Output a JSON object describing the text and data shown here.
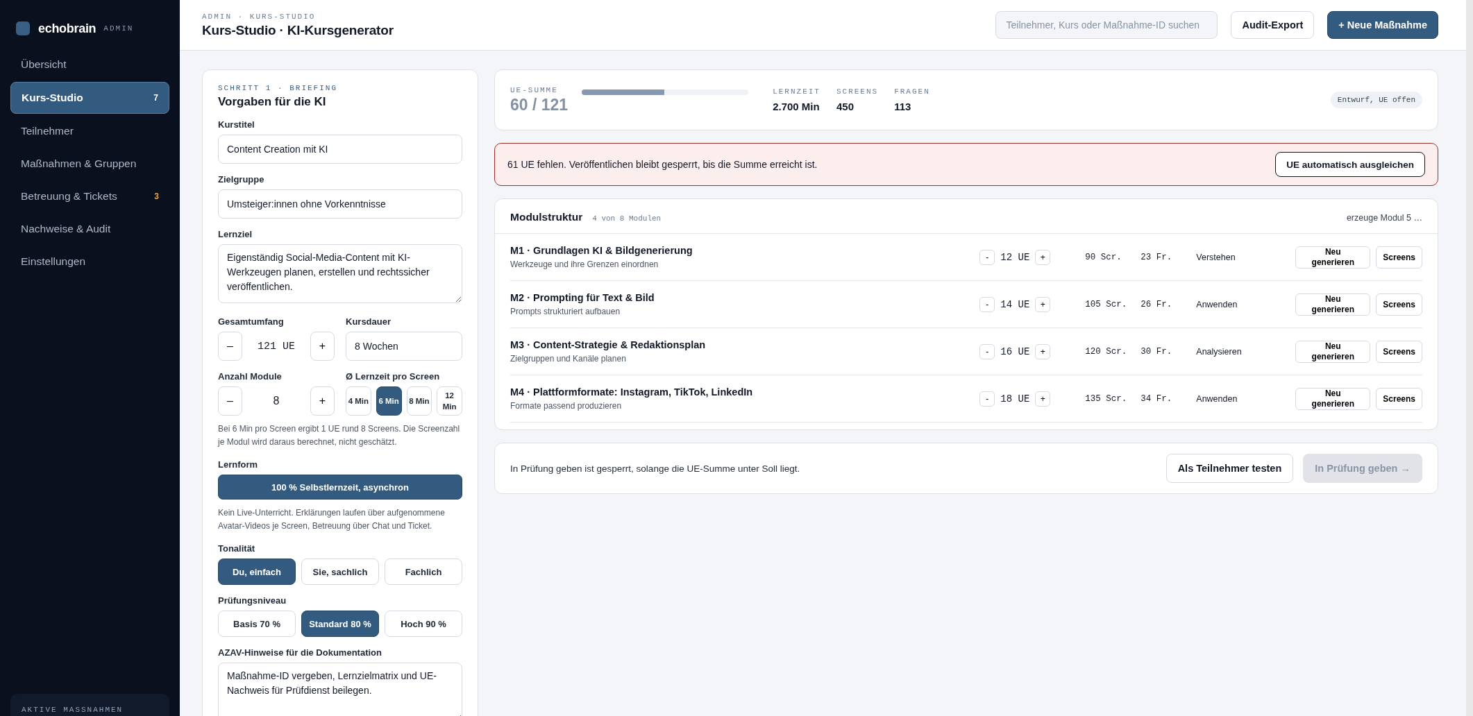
{
  "sidebar": {
    "logo": "echobrain",
    "badge": "ADMIN",
    "items": [
      {
        "label": "Übersicht",
        "selected": false
      },
      {
        "label": "Kurs-Studio",
        "selected": true,
        "count": "7"
      },
      {
        "label": "Teilnehmer",
        "selected": false
      },
      {
        "label": "Maßnahmen & Gruppen",
        "selected": false
      },
      {
        "label": "Betreuung & Tickets",
        "selected": false,
        "count": "3"
      },
      {
        "label": "Nachweise & Audit",
        "selected": false
      },
      {
        "label": "Einstellungen",
        "selected": false
      }
    ],
    "footer_label": "AKTIVE MASSNAHMEN"
  },
  "header": {
    "breadcrumb": "ADMIN · KURS-STUDIO",
    "title": "Kurs-Studio · KI-Kursgenerator",
    "search": {
      "placeholder": "Teilnehmer, Kurs oder Maßnahme-ID suchen"
    },
    "buttons": [
      {
        "label": "Audit-Export",
        "primary": false
      },
      {
        "label": "+ Neue Maßnahme",
        "primary": true
      }
    ]
  },
  "briefing": {
    "step": "SCHRITT 1 · BRIEFING",
    "title": "Vorgaben für die KI",
    "kurstitel": {
      "label": "Kurstitel",
      "value": "Content Creation mit KI"
    },
    "zielgruppe": {
      "label": "Zielgruppe",
      "value": "Umsteiger:innen ohne Vorkenntnisse"
    },
    "lernziel": {
      "label": "Lernziel",
      "value": "Eigenständig Social-Media-Content mit KI-Werkzeugen planen, erstellen und rechtssicher veröffentlichen."
    },
    "gesamtumfang": {
      "label": "Gesamtumfang",
      "minus": "–",
      "value": "121 UE",
      "plus": "+"
    },
    "kursdauer": {
      "label": "Kursdauer",
      "value": "8 Wochen"
    },
    "module_count": {
      "label": "Anzahl Module",
      "minus": "–",
      "value": "8",
      "plus": "+"
    },
    "screen_time": {
      "label": "Ø Lernzeit pro Screen",
      "options": [
        {
          "label": "4 Min",
          "selected": false
        },
        {
          "label": "6 Min",
          "selected": true
        },
        {
          "label": "8 Min",
          "selected": false
        },
        {
          "label": "12 Min",
          "selected": false
        }
      ]
    },
    "screen_note": "Bei 6 Min pro Screen ergibt 1 UE rund 8 Screens. Die Screenzahl je Modul wird daraus berechnet, nicht geschätzt.",
    "lernform": {
      "label": "Lernform",
      "value": "100 % Selbstlernzeit, asynchron",
      "note": "Kein Live-Unterricht. Erklärungen laufen über aufgenommene Avatar-Videos je Screen, Betreuung über Chat und Ticket."
    },
    "tonalitaet": {
      "label": "Tonalität",
      "options": [
        {
          "label": "Du, einfach",
          "selected": true
        },
        {
          "label": "Sie, sachlich",
          "selected": false
        },
        {
          "label": "Fachlich",
          "selected": false
        }
      ]
    },
    "pruefungsniveau": {
      "label": "Prüfungsniveau",
      "options": [
        {
          "label": "Basis 70 %",
          "selected": false
        },
        {
          "label": "Standard 80 %",
          "selected": true
        },
        {
          "label": "Hoch 90 %",
          "selected": false
        }
      ]
    },
    "azav": {
      "label": "AZAV-Hinweise für die Dokumentation",
      "value": "Maßnahme-ID vergeben, Lernzielmatrix und UE-Nachweis für Prüfdienst beilegen."
    }
  },
  "summary": {
    "ue_label": "UE-SUMME",
    "ue_value": "60 / 121",
    "level": 0.496,
    "stats": [
      {
        "label": "LERNZEIT",
        "value": "2.700 Min"
      },
      {
        "label": "SCREENS",
        "value": "450"
      },
      {
        "label": "FRAGEN",
        "value": "113"
      }
    ],
    "status": "Entwurf, UE offen"
  },
  "alert": {
    "text": "61 UE fehlen. Veröffentlichen bleibt gesperrt, bis die Summe erreicht ist.",
    "button": "UE automatisch ausgleichen"
  },
  "modules": {
    "title": "Modulstruktur",
    "count": "4 von 8 Modulen",
    "status": "erzeuge Modul 5 …",
    "rows": [
      {
        "title": "M1 · Grundlagen KI & Bildgenerierung",
        "subtitle": "Werkzeuge und ihre Grenzen einordnen",
        "minus": "-",
        "ue": "12 UE",
        "plus": "+",
        "screens": "90 Scr.",
        "questions": "23 Fr.",
        "level": "Verstehen",
        "actions": [
          "Neu generieren",
          "Screens"
        ]
      },
      {
        "title": "M2 · Prompting für Text & Bild",
        "subtitle": "Prompts strukturiert aufbauen",
        "minus": "-",
        "ue": "14 UE",
        "plus": "+",
        "screens": "105 Scr.",
        "questions": "26 Fr.",
        "level": "Anwenden",
        "actions": [
          "Neu generieren",
          "Screens"
        ]
      },
      {
        "title": "M3 · Content-Strategie & Redaktionsplan",
        "subtitle": "Zielgruppen und Kanäle planen",
        "minus": "-",
        "ue": "16 UE",
        "plus": "+",
        "screens": "120 Scr.",
        "questions": "30 Fr.",
        "level": "Analysieren",
        "actions": [
          "Neu generieren",
          "Screens"
        ]
      },
      {
        "title": "M4 · Plattformformate: Instagram, TikTok, LinkedIn",
        "subtitle": "Formate passend produzieren",
        "minus": "-",
        "ue": "18 UE",
        "plus": "+",
        "screens": "135 Scr.",
        "questions": "34 Fr.",
        "level": "Anwenden",
        "actions": [
          "Neu generieren",
          "Screens"
        ]
      }
    ]
  },
  "footer": {
    "note": "In Prüfung geben ist gesperrt, solange die UE-Summe unter Soll liegt.",
    "buttons": [
      {
        "label": "Als Teilnehmer testen",
        "disabled": false
      },
      {
        "label": "In Prüfung geben →",
        "disabled": true
      }
    ]
  }
}
